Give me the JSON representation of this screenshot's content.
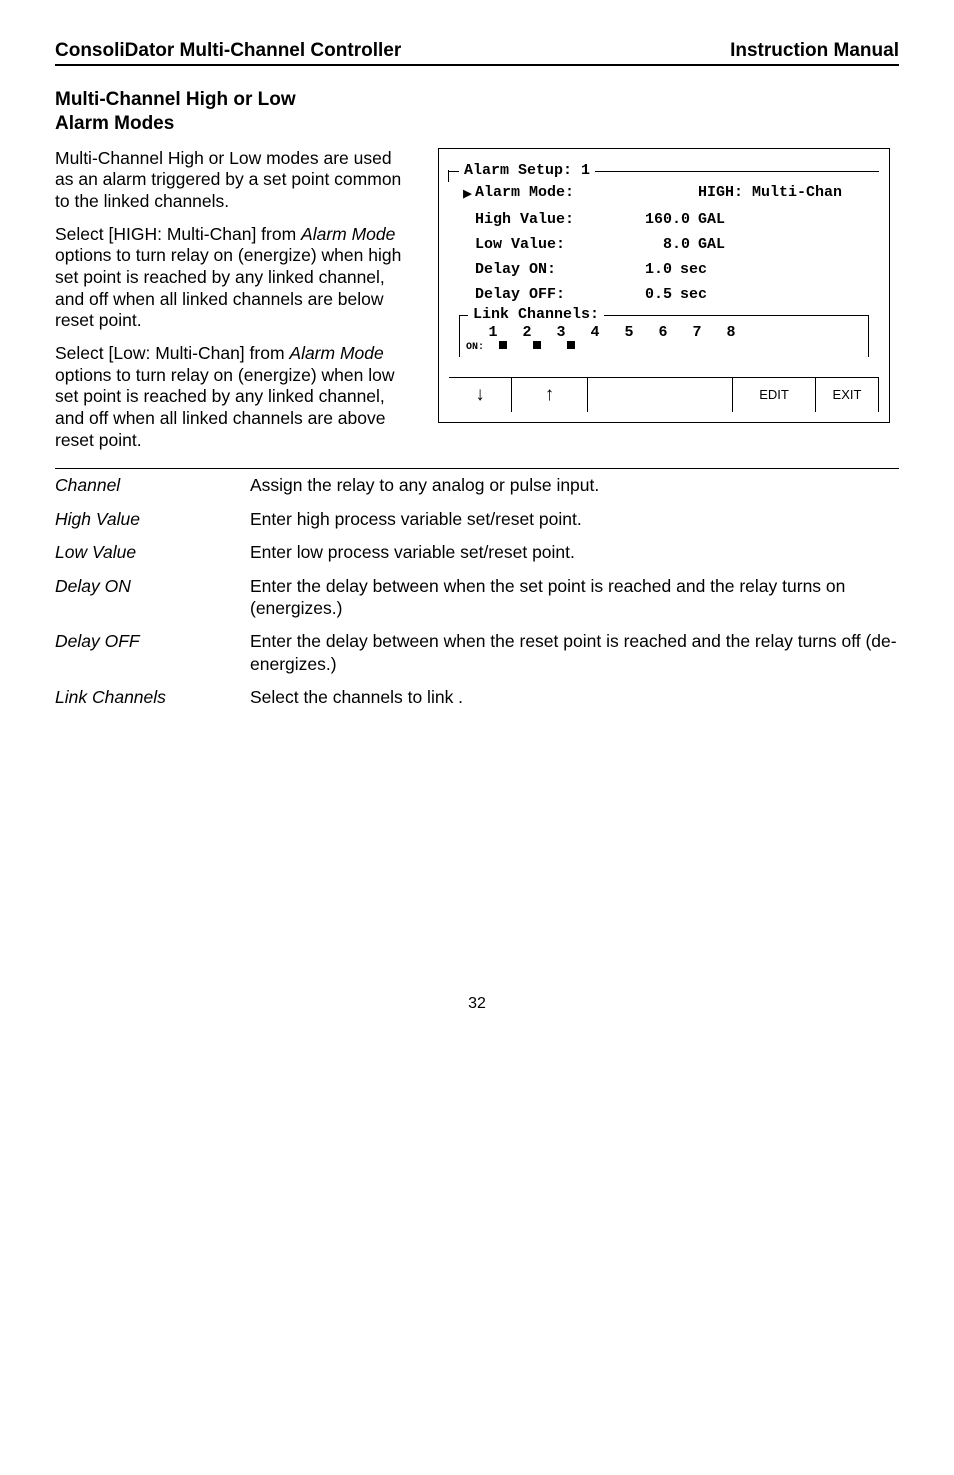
{
  "header": {
    "left": "ConsoliDator Multi-Channel Controller",
    "right": "Instruction Manual"
  },
  "section": {
    "title_line1": "Multi-Channel High or Low",
    "title_line2": "Alarm Modes"
  },
  "paragraphs": {
    "p1": "Multi-Channel High or Low modes are used as an alarm triggered by a set point common to the linked channels.",
    "p2": "Select [HIGH: Multi-Chan] from Alarm Mode options to turn relay on (energize) when high set point is reached by any linked channel, and off when all linked channels are below reset point.",
    "p3": "Select [Low: Multi-Chan] from Alarm Mode options to turn relay on (energize) when low set point is reached by any linked channel, and off when all linked channels are above reset point."
  },
  "lcd": {
    "group_title": "Alarm Setup: 1",
    "rows": {
      "mode": {
        "label": "Alarm Mode:",
        "value": "",
        "unit": "HIGH: Multi-Chan",
        "selected": true
      },
      "high": {
        "label": "High Value:",
        "value": "160.0",
        "unit": "GAL"
      },
      "low": {
        "label": "Low Value:",
        "value": "8.0",
        "unit": "GAL"
      },
      "delay_on": {
        "label": " Delay ON:",
        "value": "1.0",
        "unit": " sec"
      },
      "delay_off": {
        "label": "Delay OFF:",
        "value": "0.5",
        "unit": " sec"
      }
    },
    "link": {
      "title": "Link Channels:",
      "nums": [
        "1",
        "2",
        "3",
        "4",
        "5",
        "6",
        "7",
        "8"
      ],
      "on_label": "ON:",
      "on_flags": [
        true,
        true,
        true,
        false,
        false,
        false,
        false,
        false
      ]
    },
    "buttons": {
      "down": "↓",
      "up": "↑",
      "blank": "",
      "edit": "EDIT",
      "exit": "EXIT"
    }
  },
  "definitions": [
    {
      "term": "Channel",
      "body": "Assign the relay to any analog or pulse input."
    },
    {
      "term": "High Value",
      "body": "Enter high process variable set/reset point."
    },
    {
      "term": "Low Value",
      "body": "Enter low process variable set/reset point."
    },
    {
      "term": "Delay ON",
      "body": "Enter the delay between when the set point is reached and the relay turns on (energizes.)"
    },
    {
      "term": "Delay OFF",
      "body": "Enter the delay between when the reset point is reached and the relay turns off (de-energizes.)"
    },
    {
      "term": "Link Channels",
      "body": "Select the channels to link ."
    }
  ],
  "page_number": "32"
}
